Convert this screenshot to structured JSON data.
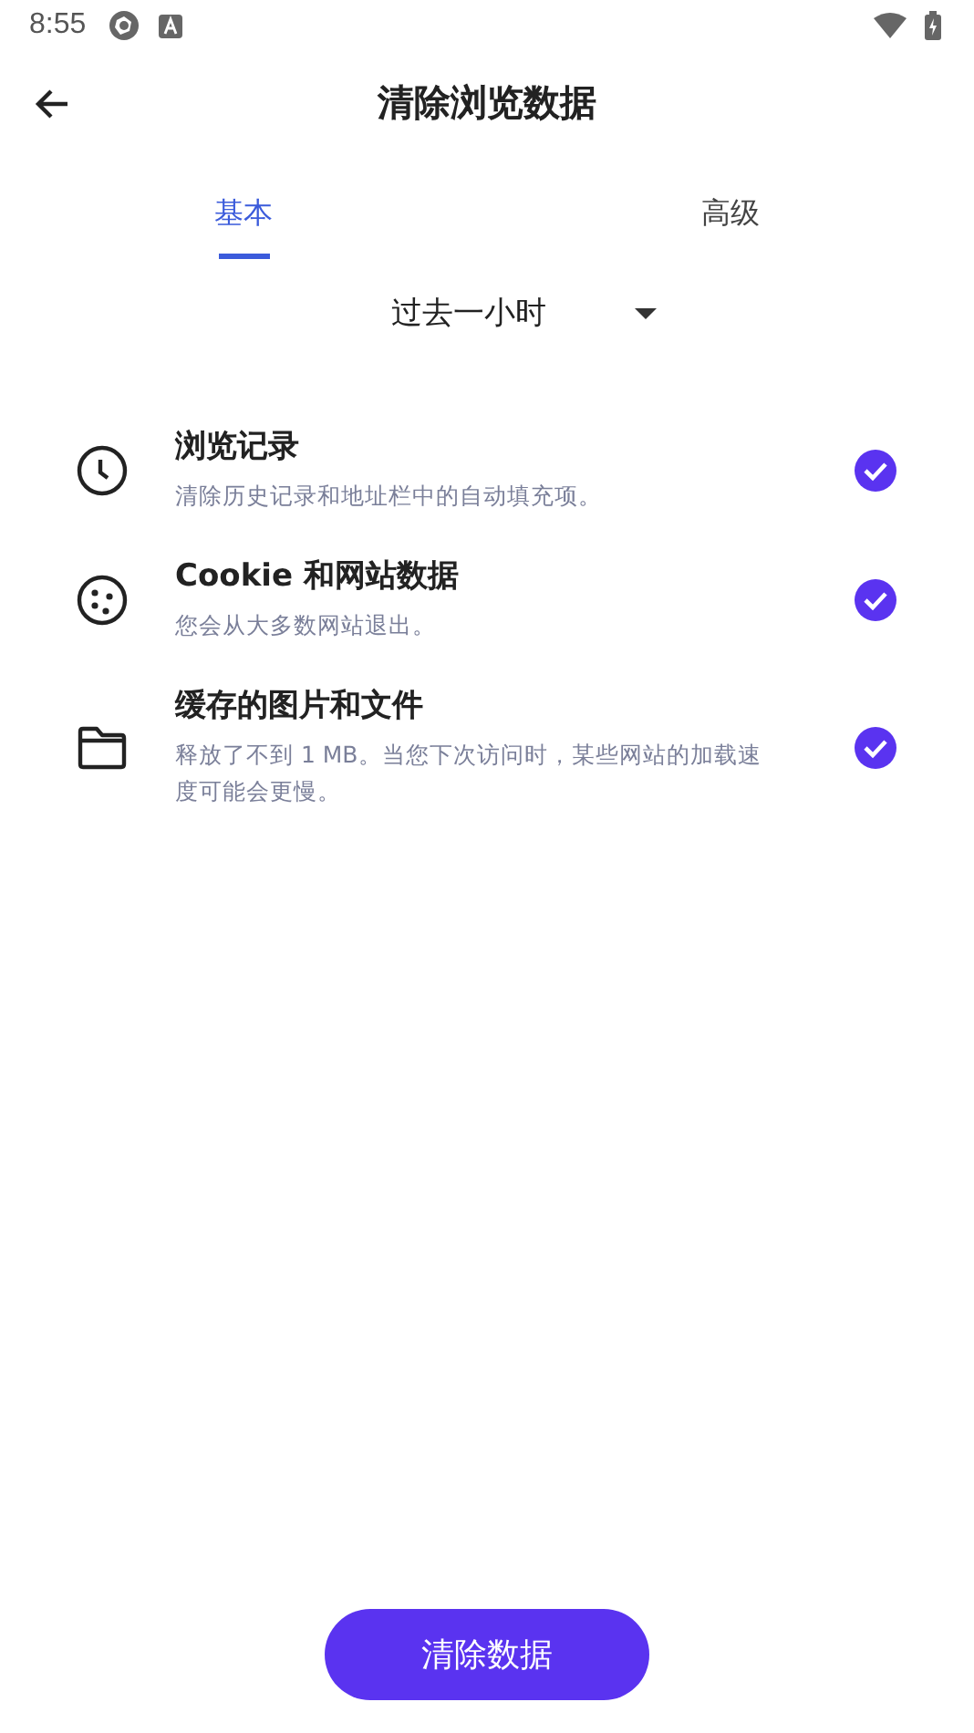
{
  "status_bar": {
    "time": "8:55"
  },
  "toolbar": {
    "title": "清除浏览数据"
  },
  "tabs": [
    {
      "label": "基本",
      "selected": true
    },
    {
      "label": "高级",
      "selected": false
    }
  ],
  "time_range": {
    "value": "过去一小时"
  },
  "items": [
    {
      "kind": "clock",
      "title": "浏览记录",
      "description": "清除历史记录和地址栏中的自动填充项。",
      "checked": true
    },
    {
      "kind": "cookie",
      "title": "Cookie 和网站数据",
      "description": "您会从大多数网站退出。",
      "checked": true
    },
    {
      "kind": "folder",
      "title": "缓存的图片和文件",
      "description": "释放了不到 1 MB。当您下次访问时，某些网站的加载速度可能会更慢。",
      "checked": true
    }
  ],
  "button": {
    "label": "清除数据"
  }
}
